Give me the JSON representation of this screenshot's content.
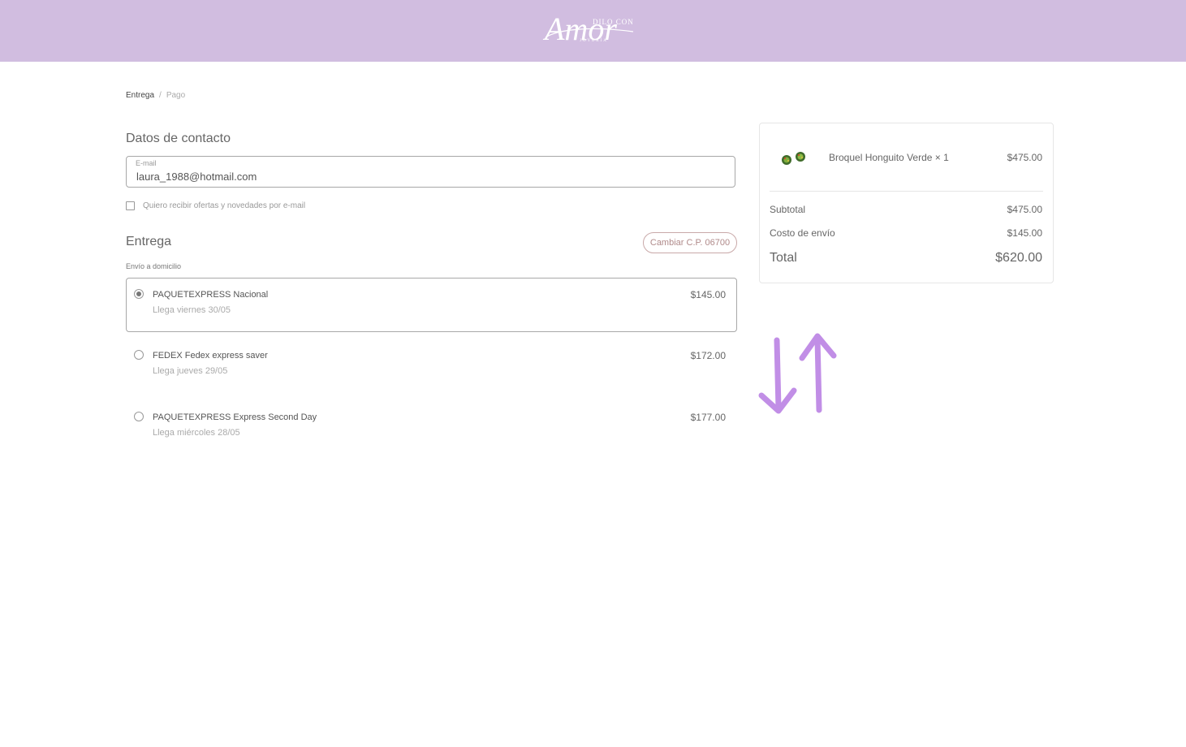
{
  "brand": {
    "logo_word": "Amor",
    "logo_small_top": "DILO CON",
    "logo_small_bottom": "JOYERÍA",
    "header_color": "#d1bde0"
  },
  "breadcrumb": {
    "step1": "Entrega",
    "separator": "/",
    "step2": "Pago"
  },
  "contact": {
    "title": "Datos de contacto",
    "email_label": "E-mail",
    "email_value": "laura_1988@hotmail.com",
    "newsletter_label": "Quiero recibir ofertas y novedades por e-mail",
    "newsletter_checked": false
  },
  "delivery": {
    "title": "Entrega",
    "change_cp_button": "Cambiar C.P. 06700",
    "method_label": "Envío a domicilio",
    "options": [
      {
        "name": "PAQUETEXPRESS Nacional",
        "eta": "Llega viernes 30/05",
        "price": "$145.00",
        "selected": true
      },
      {
        "name": "FEDEX Fedex express saver",
        "eta": "Llega jueves 29/05",
        "price": "$172.00",
        "selected": false
      },
      {
        "name": "PAQUETEXPRESS Express Second Day",
        "eta": "Llega miércoles 28/05",
        "price": "$177.00",
        "selected": false
      }
    ]
  },
  "summary": {
    "product_name": "Broquel Honguito Verde × 1",
    "product_price": "$475.00",
    "subtotal_label": "Subtotal",
    "subtotal_value": "$475.00",
    "shipping_label": "Costo de envío",
    "shipping_value": "$145.00",
    "total_label": "Total",
    "total_value": "$620.00"
  },
  "annotation": {
    "icon": "up-down-arrows-icon",
    "color": "#c18ee6"
  }
}
